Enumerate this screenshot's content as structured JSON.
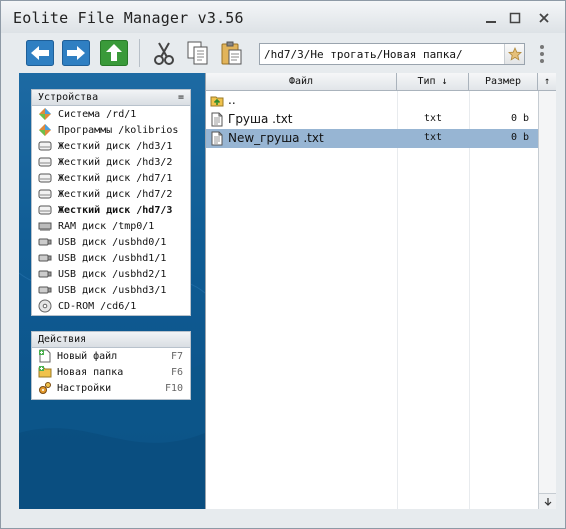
{
  "window": {
    "title": "Eolite File Manager v3.56"
  },
  "toolbar": {
    "path": "/hd7/3/Не трогать/Новая папка/"
  },
  "devices": {
    "header": "Устройства",
    "header_toggle": "=",
    "items": [
      {
        "label": "Система /rd/1",
        "icon": "system-icon",
        "bold": false
      },
      {
        "label": "Программы /kolibrios",
        "icon": "programs-icon",
        "bold": false
      },
      {
        "label": "Жесткий диск /hd3/1",
        "icon": "hard-disk-icon",
        "bold": false
      },
      {
        "label": "Жесткий диск /hd3/2",
        "icon": "hard-disk-icon",
        "bold": false
      },
      {
        "label": "Жесткий диск /hd7/1",
        "icon": "hard-disk-icon",
        "bold": false
      },
      {
        "label": "Жесткий диск /hd7/2",
        "icon": "hard-disk-icon",
        "bold": false
      },
      {
        "label": "Жесткий диск /hd7/3",
        "icon": "hard-disk-icon",
        "bold": true
      },
      {
        "label": "RAM диск /tmp0/1",
        "icon": "ram-disk-icon",
        "bold": false
      },
      {
        "label": "USB диск /usbhd0/1",
        "icon": "usb-disk-icon",
        "bold": false
      },
      {
        "label": "USB диск /usbhd1/1",
        "icon": "usb-disk-icon",
        "bold": false
      },
      {
        "label": "USB диск /usbhd2/1",
        "icon": "usb-disk-icon",
        "bold": false
      },
      {
        "label": "USB диск /usbhd3/1",
        "icon": "usb-disk-icon",
        "bold": false
      },
      {
        "label": "CD-ROM /cd6/1",
        "icon": "cdrom-icon",
        "bold": false
      }
    ]
  },
  "actions": {
    "header": "Действия",
    "items": [
      {
        "label": "Новый файл",
        "key": "F7",
        "icon": "new-file-icon"
      },
      {
        "label": "Новая папка",
        "key": "F6",
        "icon": "new-folder-icon"
      },
      {
        "label": "Настройки",
        "key": "F10",
        "icon": "settings-icon"
      }
    ]
  },
  "file_list": {
    "columns": {
      "name": "Файл",
      "type": "Тип ↓",
      "size": "Размер",
      "sort": "↑"
    },
    "rows": [
      {
        "name": "..",
        "type": "",
        "size": "",
        "icon": "folder-up-icon",
        "selected": false
      },
      {
        "name": "Груша .txt",
        "type": "txt",
        "size": "0 b",
        "icon": "text-file-icon",
        "selected": false
      },
      {
        "name": "New_груша .txt",
        "type": "txt",
        "size": "0 b",
        "icon": "text-file-icon",
        "selected": true
      }
    ]
  },
  "colors": {
    "panel_blue": "#0f5c94",
    "selection": "#97b5d3",
    "toolbar_green": "#3a9a3a",
    "toolbar_blue": "#2f7fc2"
  }
}
